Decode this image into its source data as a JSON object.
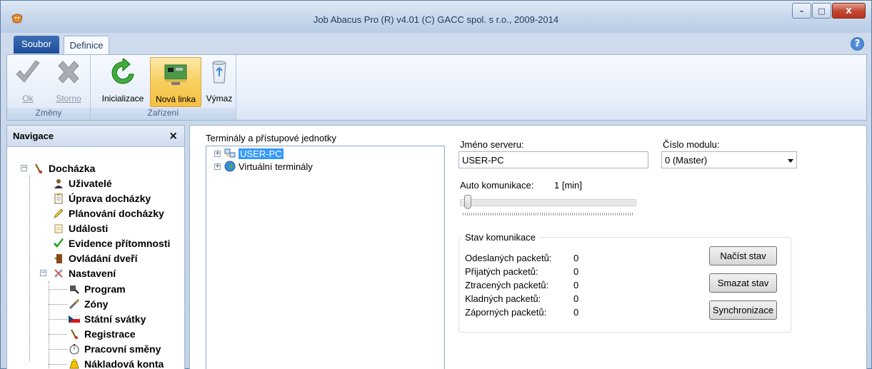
{
  "window": {
    "title": "Job Abacus Pro (R) v4.01 (C) GACC spol. s r.o., 2009-2014",
    "minimize": "–",
    "maximize": "□",
    "close": "X"
  },
  "ribbon_tabs": {
    "file": "Soubor",
    "definice": "Definice",
    "help": "?"
  },
  "ribbon": {
    "group_zmeny": "Změny",
    "group_zarizeni": "Zařízení",
    "ok": "Ok",
    "storno": "Storno",
    "inicializace": "Inicializace",
    "nova_linka": "Nová linka",
    "vymaz": "Výmaz"
  },
  "navigation": {
    "title": "Navigace",
    "close": "×",
    "items": {
      "dochazka": "Docházka",
      "uzivatele": "Uživatelé",
      "uprava": "Úprava docházky",
      "planovani": "Plánování docházky",
      "udalosti": "Události",
      "evidence": "Evidence přítomnosti",
      "ovladani": "Ovládání dveří",
      "nastaveni": "Nastavení",
      "program": "Program",
      "zony": "Zóny",
      "svatky": "Státní svátky",
      "registrace": "Registrace",
      "smeny": "Pracovní směny",
      "naklady": "Nákladová konta"
    }
  },
  "content": {
    "tree_label": "Terminály a přístupové jednotky",
    "tree_nodes": {
      "user_pc": "USER-PC",
      "virtual": "Virtuální terminály"
    },
    "server_label": "Jméno serveru:",
    "server_value": "USER-PC",
    "module_label": "Číslo modulu:",
    "module_value": "0 (Master)",
    "auto_label": "Auto komunikace:",
    "auto_value": "1 [min]",
    "auto_slider_fraction": 0.0,
    "stav_title": "Stav komunikace",
    "stats": {
      "sent_label": "Odeslaných packetů:",
      "sent_value": "0",
      "recv_label": "Přijatých packetů:",
      "recv_value": "0",
      "lost_label": "Ztracených packetů:",
      "lost_value": "0",
      "pos_label": "Kladných packetů:",
      "pos_value": "0",
      "neg_label": "Záporných packetů:",
      "neg_value": "0"
    },
    "buttons": {
      "nacist": "Načíst stav",
      "smazat": "Smazat stav",
      "sync": "Synchronizace"
    }
  },
  "colors": {
    "accent": "#1c4e98",
    "selection": "#3399ff",
    "active_button": "#f7cf5e"
  }
}
